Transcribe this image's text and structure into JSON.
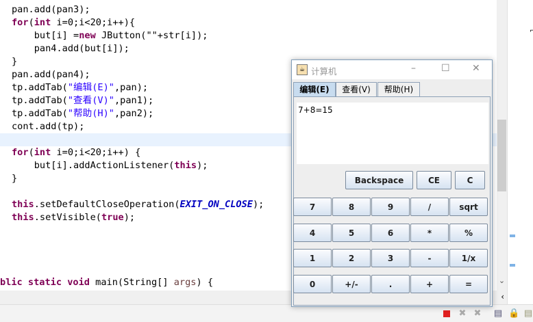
{
  "code": [
    [
      [
        "pan.add(pan3);",
        ""
      ]
    ],
    [
      [
        "for",
        "kw"
      ],
      [
        "(",
        ""
      ],
      [
        "int",
        "kw"
      ],
      [
        " i=0;i<20;i++){",
        ""
      ]
    ],
    [
      [
        "    but[i] =",
        ""
      ],
      [
        "new",
        "kw"
      ],
      [
        " JButton(\"\"+str[i]);",
        ""
      ]
    ],
    [
      [
        "    pan4.add(but[i]);",
        ""
      ]
    ],
    [
      [
        "}",
        ""
      ]
    ],
    [
      [
        "pan.add(pan4);",
        ""
      ]
    ],
    [
      [
        "tp.addTab(",
        ""
      ],
      [
        "\"编辑(E)\"",
        "id"
      ],
      [
        ",pan);",
        ""
      ]
    ],
    [
      [
        "tp.addTab(",
        ""
      ],
      [
        "\"查看(V)\"",
        "id"
      ],
      [
        ",pan1);",
        ""
      ]
    ],
    [
      [
        "tp.addTab(",
        ""
      ],
      [
        "\"帮助(H)\"",
        "id"
      ],
      [
        ",pan2);",
        ""
      ]
    ],
    [
      [
        "cont.add(tp);",
        ""
      ]
    ],
    [
      [
        "",
        ""
      ]
    ],
    [
      [
        "for",
        "kw"
      ],
      [
        "(",
        ""
      ],
      [
        "int",
        "kw"
      ],
      [
        " i=0;i<20;i++) {",
        ""
      ]
    ],
    [
      [
        "    but[i].addActionListener(",
        ""
      ],
      [
        "this",
        "kw"
      ],
      [
        ");",
        ""
      ]
    ],
    [
      [
        "}",
        ""
      ]
    ],
    [
      [
        "",
        ""
      ]
    ],
    [
      [
        "this",
        "kw"
      ],
      [
        ".setDefaultCloseOperation(",
        ""
      ],
      [
        "EXIT_ON_CLOSE",
        "fld"
      ],
      [
        ");",
        ""
      ]
    ],
    [
      [
        "this",
        "kw"
      ],
      [
        ".setVisible(",
        ""
      ],
      [
        "true",
        "kw"
      ],
      [
        ");",
        ""
      ]
    ],
    [
      [
        "",
        ""
      ]
    ],
    [
      [
        "",
        ""
      ]
    ],
    [
      [
        "",
        ""
      ]
    ],
    [
      [
        "",
        ""
      ]
    ],
    [
      [
        "blic ",
        "kw"
      ],
      [
        "static",
        "kw"
      ],
      [
        " ",
        ""
      ],
      [
        "void",
        "kw"
      ],
      [
        " main(String[] ",
        ""
      ],
      [
        "args",
        "var"
      ],
      [
        ") {",
        ""
      ]
    ]
  ],
  "calc": {
    "title": "计算机",
    "tabs": [
      "编辑(E)",
      "查看(V)",
      "帮助(H)"
    ],
    "display": "7+8=15",
    "top_buttons": [
      "Backspace",
      "CE",
      "C"
    ],
    "grid": [
      [
        "7",
        "8",
        "9",
        "/",
        "sqrt"
      ],
      [
        "4",
        "5",
        "6",
        "*",
        "%"
      ],
      [
        "1",
        "2",
        "3",
        "-",
        "1/x"
      ],
      [
        "0",
        "+/-",
        ".",
        "+",
        "="
      ]
    ]
  }
}
